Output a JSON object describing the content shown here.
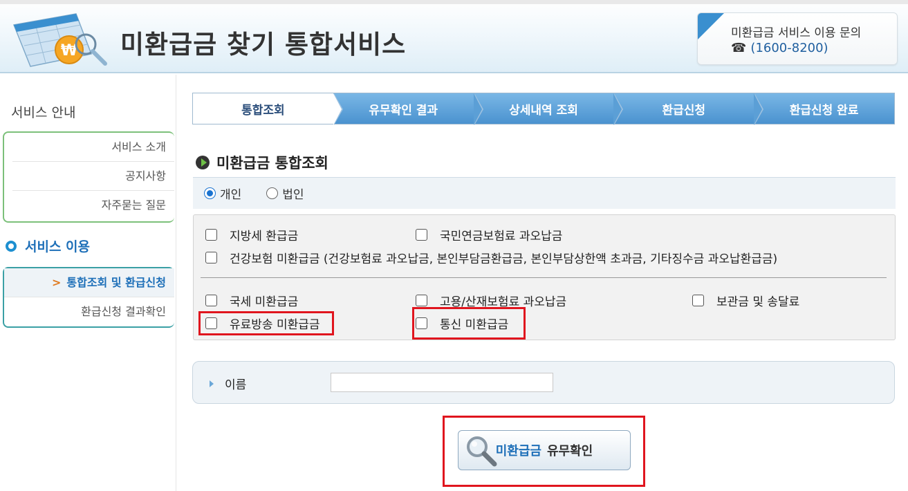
{
  "header": {
    "title": "미환급금 찾기 통합서비스",
    "contact_title": "미환급금 서비스 이용 문의",
    "contact_phone_icon": "☎",
    "contact_phone": "(1600-8200)"
  },
  "sidebar": {
    "heading": "서비스 안내",
    "info_items": [
      {
        "label": "서비스 소개"
      },
      {
        "label": "공지사항"
      },
      {
        "label": "자주묻는 질문"
      }
    ],
    "section_label": "서비스 이용",
    "use_items": [
      {
        "label": "통합조회 및 환급신청",
        "active": true,
        "prefix": ">"
      },
      {
        "label": "환급신청 결과확인",
        "active": false
      }
    ]
  },
  "steps": [
    {
      "label": "통합조회",
      "active": true
    },
    {
      "label": "유무확인 결과",
      "active": false
    },
    {
      "label": "상세내역 조회",
      "active": false
    },
    {
      "label": "환급신청",
      "active": false
    },
    {
      "label": "환급신청 완료",
      "active": false
    }
  ],
  "section_title": "미환급금 통합조회",
  "person_type": {
    "options": [
      {
        "label": "개인",
        "checked": true
      },
      {
        "label": "법인",
        "checked": false
      }
    ]
  },
  "checkboxes": {
    "local_tax": "지방세 환급금",
    "pension": "국민연금보험료 과오납금",
    "health": "건강보험 미환급금 (건강보험료 과오납금, 본인부담금환급금, 본인부담상한액 초과금, 기타징수금 과오납환급금)",
    "national_tax": "국세 미환급금",
    "employment": "고용/산재보험료 과오납금",
    "storage": "보관금 및 송달료",
    "broadcast": "유료방송 미환급금",
    "telecom": "통신 미환급금"
  },
  "name_field": {
    "label": "이름",
    "value": "",
    "placeholder": ""
  },
  "search_button": {
    "accent": "미환급금",
    "label": "유무확인"
  },
  "colors": {
    "highlight": "#e0151e",
    "accent": "#1d6fb8",
    "step_bg": "#5b9fd6"
  }
}
